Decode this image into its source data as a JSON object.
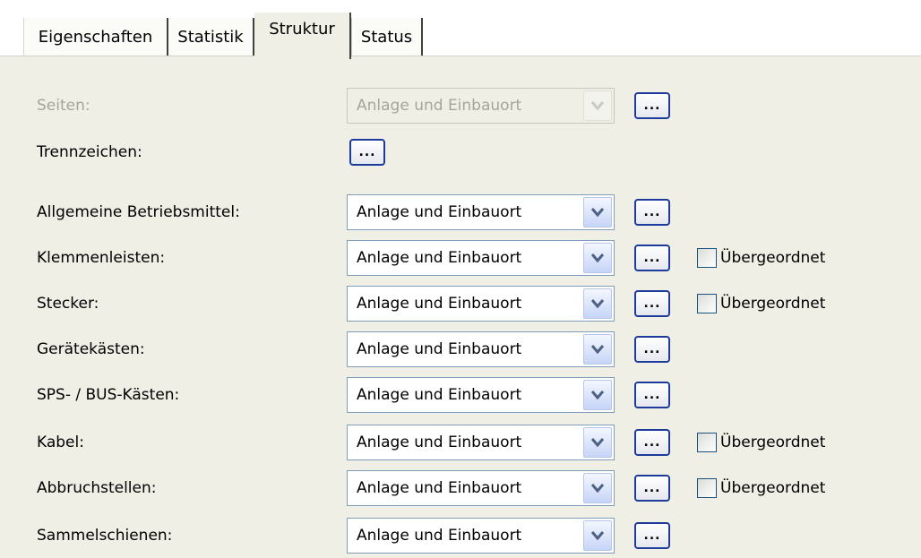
{
  "tabs": [
    {
      "label": "Eigenschaften",
      "active": false
    },
    {
      "label": "Statistik",
      "active": false
    },
    {
      "label": "Struktur",
      "active": true
    },
    {
      "label": "Status",
      "active": false
    }
  ],
  "pages": {
    "label": "Seiten:",
    "value": "Anlage und Einbauort",
    "enabled": false
  },
  "separator": {
    "label": "Trennzeichen:"
  },
  "ellipsis_label": "...",
  "checkbox_label": "Übergeordnet",
  "fields": [
    {
      "label": "Allgemeine Betriebsmittel:",
      "value": "Anlage und Einbauort",
      "has_checkbox": false
    },
    {
      "label": "Klemmenleisten:",
      "value": "Anlage und Einbauort",
      "has_checkbox": true,
      "checked": false
    },
    {
      "label": "Stecker:",
      "value": "Anlage und Einbauort",
      "has_checkbox": true,
      "checked": false
    },
    {
      "label": "Gerätekästen:",
      "value": "Anlage und Einbauort",
      "has_checkbox": false
    },
    {
      "label": "SPS- / BUS-Kästen:",
      "value": "Anlage und Einbauort",
      "has_checkbox": false
    },
    {
      "label": "Kabel:",
      "value": "Anlage und Einbauort",
      "has_checkbox": true,
      "checked": false
    },
    {
      "label": "Abbruchstellen:",
      "value": "Anlage und Einbauort",
      "has_checkbox": true,
      "checked": false
    },
    {
      "label": "Sammelschienen:",
      "value": "Anlage und Einbauort",
      "has_checkbox": false
    }
  ],
  "colors": {
    "panel": "#f0efe6",
    "button_border": "#1c3b9a",
    "disabled_text": "#a5a599"
  }
}
